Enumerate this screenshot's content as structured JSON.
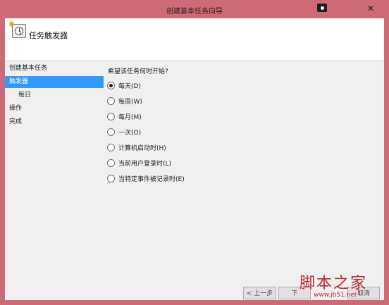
{
  "window": {
    "title": "创建基本任务向导",
    "close_label": "✕"
  },
  "header": {
    "heading": "任务触发器"
  },
  "sidebar": {
    "items": [
      {
        "label": "创建基本任务"
      },
      {
        "label": "触发器",
        "active": true
      },
      {
        "label": "每日"
      },
      {
        "label": "操作"
      },
      {
        "label": "完成"
      }
    ]
  },
  "content": {
    "question": "希望该任务何时开始?",
    "options": [
      {
        "label": "每天(D)",
        "selected": true
      },
      {
        "label": "每周(W)",
        "selected": false
      },
      {
        "label": "每月(M)",
        "selected": false
      },
      {
        "label": "一次(O)",
        "selected": false
      },
      {
        "label": "计算机启动时(H)",
        "selected": false
      },
      {
        "label": "当前用户登录时(L)",
        "selected": false
      },
      {
        "label": "当特定事件被记录时(E)",
        "selected": false
      }
    ]
  },
  "footer": {
    "back_label": "< 上一步",
    "next_label": "下",
    "cancel_label": "取消"
  },
  "watermark": {
    "brand": "脚本之家",
    "url": "www.jb51.net"
  }
}
